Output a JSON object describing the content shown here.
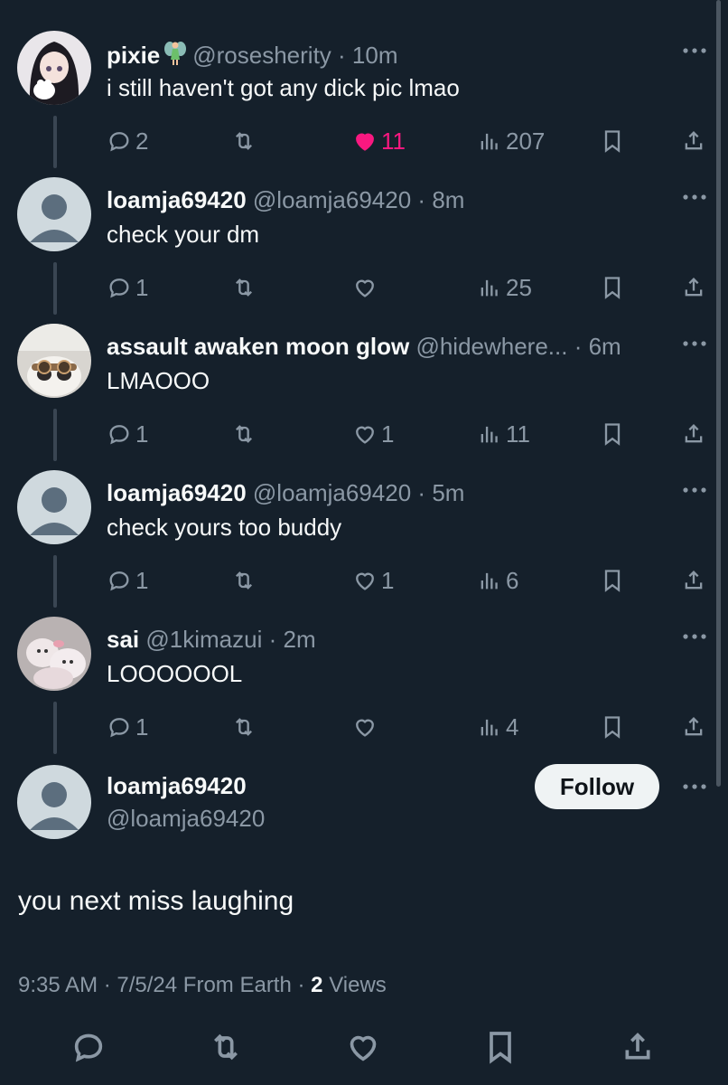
{
  "replies": [
    {
      "name": "pixie",
      "has_fairy_emoji": true,
      "handle": "@rosesherity",
      "time": "10m",
      "text": "i still haven't got any dick pic lmao",
      "avatar": "anime-avatar",
      "comments": "2",
      "retweets": "",
      "likes": "11",
      "liked": true,
      "views": "207"
    },
    {
      "name": "loamja69420",
      "handle": "@loamja69420",
      "time": "8m",
      "text": "check your dm",
      "avatar": "default-avatar",
      "comments": "1",
      "retweets": "",
      "likes": "",
      "liked": false,
      "views": "25"
    },
    {
      "name": "assault awaken moon glow",
      "handle": "@hidewhere...",
      "time": "6m",
      "text": "LMAOOO",
      "avatar": "panda-plush-avatar",
      "comments": "1",
      "retweets": "",
      "likes": "1",
      "liked": false,
      "views": "11"
    },
    {
      "name": "loamja69420",
      "handle": "@loamja69420",
      "time": "5m",
      "text": "check yours too buddy",
      "avatar": "default-avatar",
      "comments": "1",
      "retweets": "",
      "likes": "1",
      "liked": false,
      "views": "6"
    },
    {
      "name": "sai",
      "handle": "@1kimazui",
      "time": "2m",
      "text": "LOOOOOOL",
      "avatar": "plush-photo-avatar",
      "comments": "1",
      "retweets": "",
      "likes": "",
      "liked": false,
      "views": "4"
    }
  ],
  "main_tweet": {
    "name": "loamja69420",
    "handle": "@loamja69420",
    "follow_label": "Follow",
    "text": "you next miss laughing",
    "time": "9:35 AM",
    "date": "7/5/24",
    "source": "From Earth",
    "views_count": "2",
    "views_label": "Views"
  },
  "colors": {
    "background": "#15202b",
    "text": "#f7f9f9",
    "muted": "#8b98a5",
    "like": "#f91880",
    "thread_line": "#3a4653"
  }
}
